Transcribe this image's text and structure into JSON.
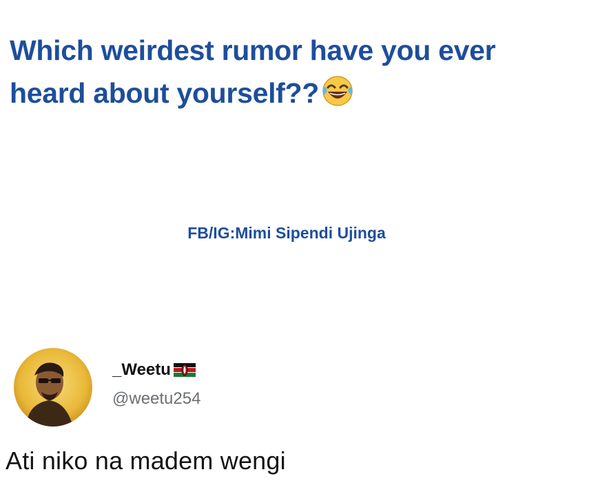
{
  "question": {
    "line1": "Which weirdest rumor have you ever",
    "line2": "heard about yourself??",
    "emoji": "laughing-tears-emoji",
    "color": "#1e4e9b"
  },
  "credit": {
    "text": "FB/IG:Mimi Sipendi Ujinga"
  },
  "tweet": {
    "display_name": "_Weetu",
    "flag": "kenya-flag-icon",
    "username": "@weetu254",
    "text": "Ati niko na madem wengi"
  }
}
